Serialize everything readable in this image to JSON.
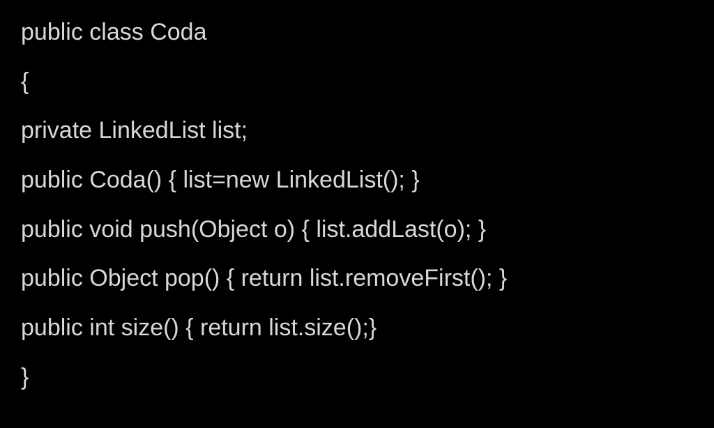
{
  "code": {
    "lines": [
      "public class Coda",
      "{",
      "private LinkedList list;",
      "public Coda() { list=new LinkedList(); }",
      "public void push(Object o) { list.addLast(o); }",
      "public Object pop() { return list.removeFirst(); }",
      "public int size() { return list.size();}",
      "}"
    ]
  }
}
